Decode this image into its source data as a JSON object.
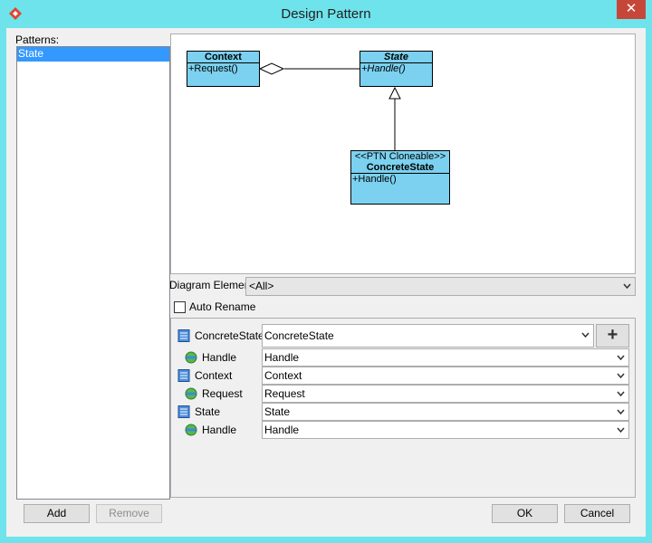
{
  "window": {
    "title": "Design Pattern",
    "close_glyph": "✕"
  },
  "patterns": {
    "label": "Patterns:",
    "items": [
      "State"
    ],
    "selected": "State"
  },
  "diagram": {
    "context": {
      "name": "Context",
      "op": "+Request()"
    },
    "state": {
      "name": "State",
      "op": "+Handle()"
    },
    "concrete": {
      "stereotype": "<<PTN Cloneable>>",
      "name": "ConcreteState",
      "op": "+Handle()"
    }
  },
  "diagram_element": {
    "label": "Diagram Element",
    "value": "<All>"
  },
  "auto_rename": {
    "label": "Auto Rename",
    "checked": false
  },
  "mapping": {
    "rows": [
      {
        "label": "ConcreteState",
        "value": "ConcreteState",
        "kind": "class"
      },
      {
        "label": "Handle",
        "value": "Handle",
        "kind": "operation"
      },
      {
        "label": "Context",
        "value": "Context",
        "kind": "class"
      },
      {
        "label": "Request",
        "value": "Request",
        "kind": "operation"
      },
      {
        "label": "State",
        "value": "State",
        "kind": "class"
      },
      {
        "label": "Handle",
        "value": "Handle",
        "kind": "operation"
      }
    ]
  },
  "buttons": {
    "add": "Add",
    "remove": "Remove",
    "ok": "OK",
    "cancel": "Cancel"
  },
  "colors": {
    "titlebar": "#6ee3ec",
    "class_fill": "#7bd1ef",
    "selection": "#3399ff",
    "close": "#c7463a"
  }
}
